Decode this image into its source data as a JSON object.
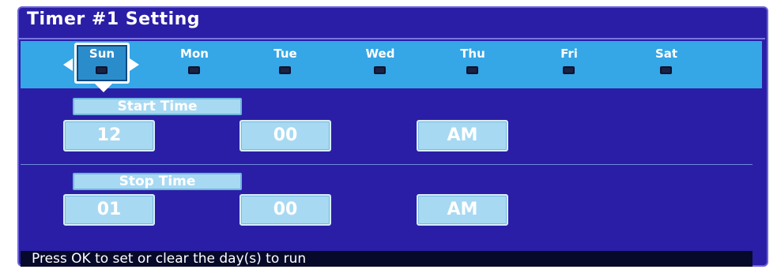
{
  "title": "Timer #1 Setting",
  "days": [
    {
      "label": "Sun",
      "selected": true
    },
    {
      "label": "Mon",
      "selected": false
    },
    {
      "label": "Tue",
      "selected": false
    },
    {
      "label": "Wed",
      "selected": false
    },
    {
      "label": "Thu",
      "selected": false
    },
    {
      "label": "Fri",
      "selected": false
    },
    {
      "label": "Sat",
      "selected": false
    }
  ],
  "start_time": {
    "label": "Start Time",
    "hour": "12",
    "minute": "00",
    "ampm": "AM"
  },
  "stop_time": {
    "label": "Stop Time",
    "hour": "01",
    "minute": "00",
    "ampm": "AM"
  },
  "hint": "Press OK to set or clear the day(s) to run",
  "colors": {
    "panel_bg": "#2a1ea6",
    "day_strip": "#35a6e6",
    "field_bg": "#a8d9f2",
    "hint_bg": "#07092a"
  }
}
